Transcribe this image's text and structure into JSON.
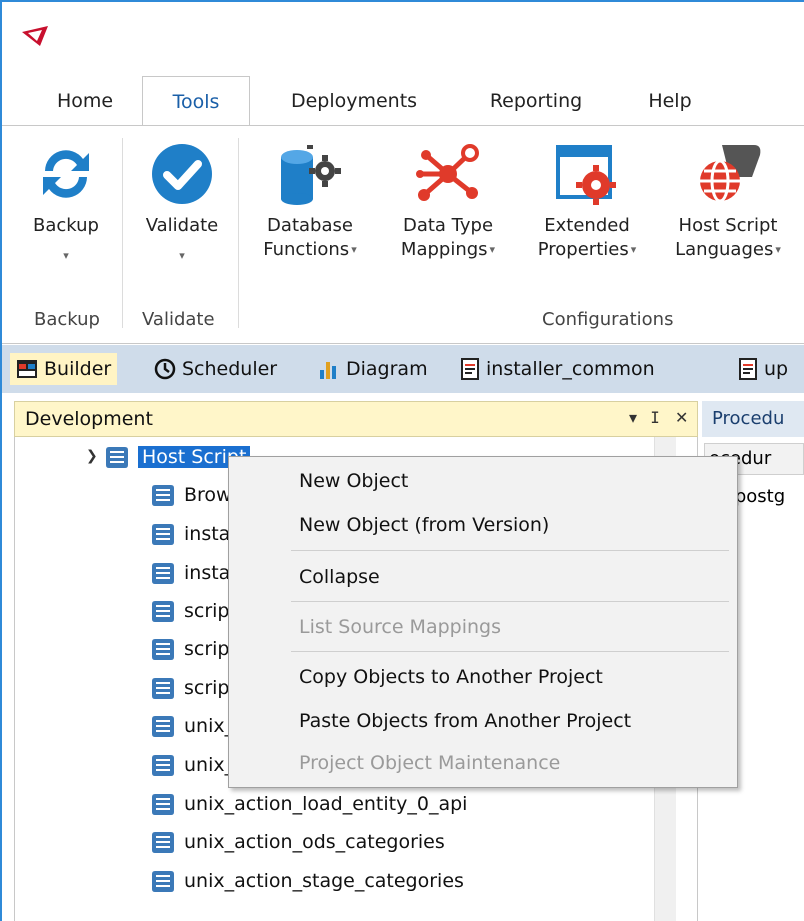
{
  "tabs": [
    "Home",
    "Tools",
    "Deployments",
    "Reporting",
    "Help"
  ],
  "active_tab": "Tools",
  "ribbon": {
    "backup": {
      "label": "Backup",
      "group": "Backup"
    },
    "validate": {
      "label": "Validate",
      "group": "Validate"
    },
    "database_functions": {
      "line1": "Database",
      "line2": "Functions"
    },
    "data_type_mappings": {
      "line1": "Data Type",
      "line2": "Mappings"
    },
    "extended_properties": {
      "line1": "Extended",
      "line2": "Properties"
    },
    "host_script_languages": {
      "line1": "Host Script",
      "line2": "Languages"
    },
    "configurations_group": "Configurations"
  },
  "doc_tabs": [
    "Builder",
    "Scheduler",
    "Diagram",
    "installer_common",
    "up"
  ],
  "dev_panel": {
    "title": "Development",
    "controls": {
      "dropdown": "▾",
      "pin": "ⵊ",
      "close": "✕"
    }
  },
  "tree": {
    "root": "Host Script",
    "items": [
      "Brow",
      "insta",
      "insta",
      "scrip",
      "scrip",
      "scrip",
      "unix_",
      "unix_",
      "unix_action_load_entity_0_api",
      "unix_action_ods_categories",
      "unix_action_stage_categories"
    ]
  },
  "right_panel": {
    "header": "Procedu",
    "column": "ocedur",
    "row": "postg"
  },
  "context_menu": {
    "items": [
      {
        "label": "New Object",
        "enabled": true
      },
      {
        "label": "New Object (from Version)",
        "enabled": true
      },
      {
        "label": "Collapse",
        "enabled": true
      },
      {
        "label": "List Source Mappings",
        "enabled": false
      },
      {
        "label": "Copy Objects to Another Project",
        "enabled": true
      },
      {
        "label": "Paste Objects from Another Project",
        "enabled": true
      },
      {
        "label": "Project Object Maintenance",
        "enabled": false
      }
    ]
  },
  "colors": {
    "accent": "#1a6fd0",
    "doc_strip": "#cfdcea",
    "panel_header": "#fff6c9",
    "icon_blue": "#1f7fc8",
    "icon_red": "#e03a2a"
  }
}
